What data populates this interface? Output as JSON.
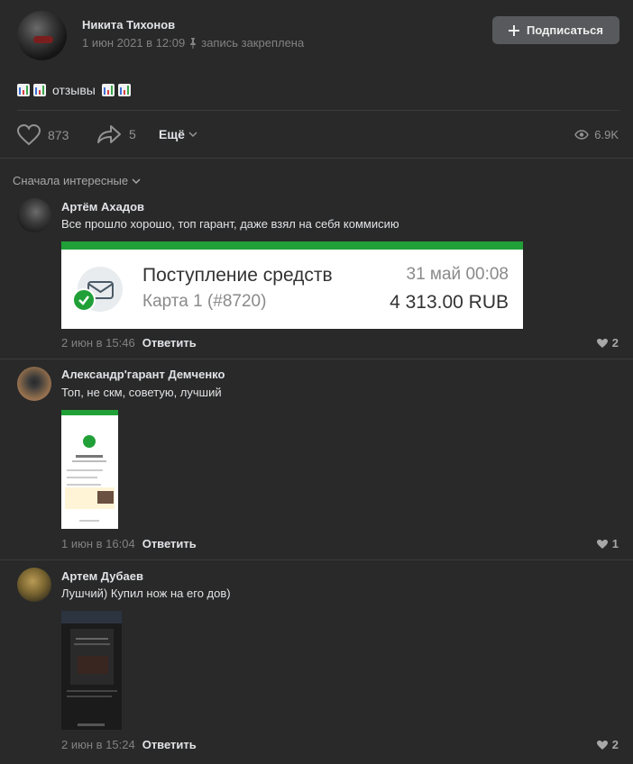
{
  "post": {
    "author": "Никита Тихонов",
    "date": "1 июн 2021 в 12:09",
    "pinned": "запись закреплена",
    "subscribe": "Подписаться",
    "text": "отзывы",
    "likes": "873",
    "shares": "5",
    "more": "Ещё",
    "views": "6.9K"
  },
  "sort": {
    "label": "Сначала интересные"
  },
  "comments": [
    {
      "author": "Артём Ахадов",
      "text": "Все прошло хорошо, топ гарант, даже взял на себя коммисию",
      "date": "2 июн в 15:46",
      "reply": "Ответить",
      "likes": "2",
      "receipt": {
        "title": "Поступление средств",
        "card": "Карта 1 (#8720)",
        "date": "31 май 00:08",
        "amount": "4 313.00 RUB"
      }
    },
    {
      "author": "Александр'гарант Демченко",
      "text": "Топ, не скм, советую, лучший",
      "date": "1 июн в 16:04",
      "reply": "Ответить",
      "likes": "1"
    },
    {
      "author": "Артем Дубаев",
      "text": "Лушчий) Купил нож на его дов)",
      "date": "2 июн в 15:24",
      "reply": "Ответить",
      "likes": "2"
    }
  ],
  "colors": {
    "background": "#292929",
    "text": "#e1e3e6",
    "muted": "#828282",
    "sber_green": "#21a038"
  }
}
